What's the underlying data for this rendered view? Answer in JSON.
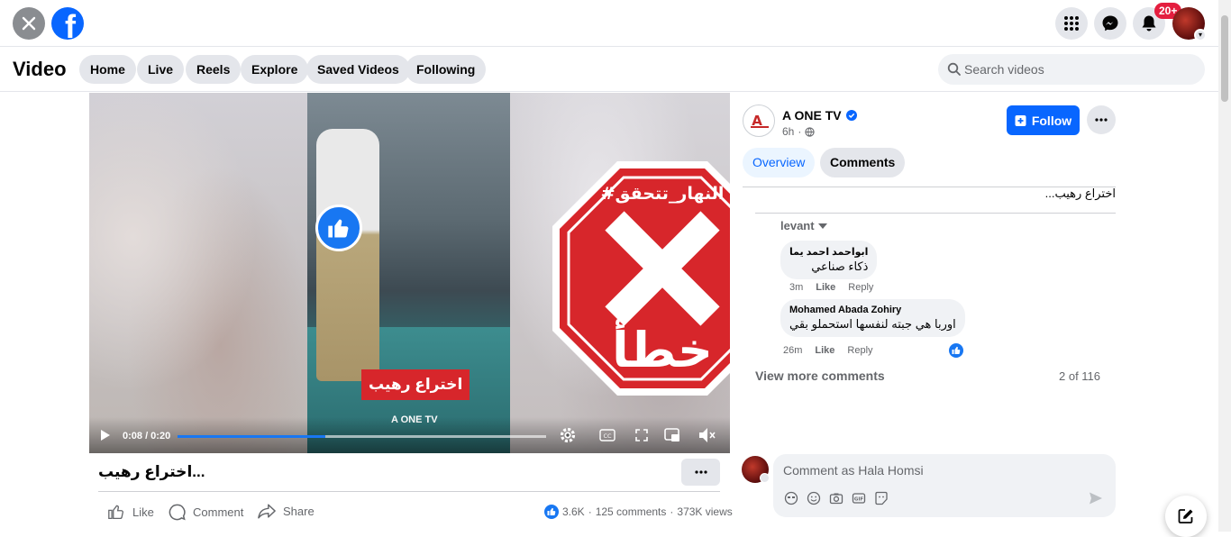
{
  "topbar": {
    "notifications_badge": "20+"
  },
  "subnav": {
    "title": "Video",
    "tabs": [
      "Home",
      "Live",
      "Reels",
      "Explore",
      "Saved Videos",
      "Following"
    ],
    "search_placeholder": "Search videos"
  },
  "video": {
    "time": "0:08 / 0:20",
    "progress_fraction": 0.4,
    "caption_overlay": "اختراع رهيب",
    "brand_overlay": "A ONE TV",
    "stamp_top_text": "#النهار_تتحقق",
    "stamp_bottom_text": "خطأ",
    "stamp_color": "#d7262b"
  },
  "post": {
    "title": "اختراع رهيب...",
    "actions": {
      "like": "Like",
      "comment": "Comment",
      "share": "Share"
    },
    "stats": {
      "reactions": "3.6K",
      "comments": "125 comments",
      "views": "373K views"
    }
  },
  "page": {
    "name": "A ONE TV",
    "time": "6h",
    "follow_label": "Follow",
    "tabs": {
      "overview": "Overview",
      "comments": "Comments"
    },
    "description": "اختراع رهيب...",
    "sort_label": "levant"
  },
  "comments": [
    {
      "author": "ابواحمد احمد يما",
      "text": "ذكاء صناعي",
      "time": "3m",
      "like": "Like",
      "reply": "Reply"
    },
    {
      "author": "Mohamed Abada Zohiry",
      "text": "اوربا هي جبته لنفسها استحملو بقي",
      "time": "26m",
      "like": "Like",
      "reply": "Reply"
    }
  ],
  "comments_footer": {
    "view_more": "View more comments",
    "count": "2 of 116"
  },
  "composer": {
    "placeholder": "Comment as Hala Homsi"
  },
  "colors": {
    "accent": "#0866ff",
    "badge": "#e41e3f"
  }
}
